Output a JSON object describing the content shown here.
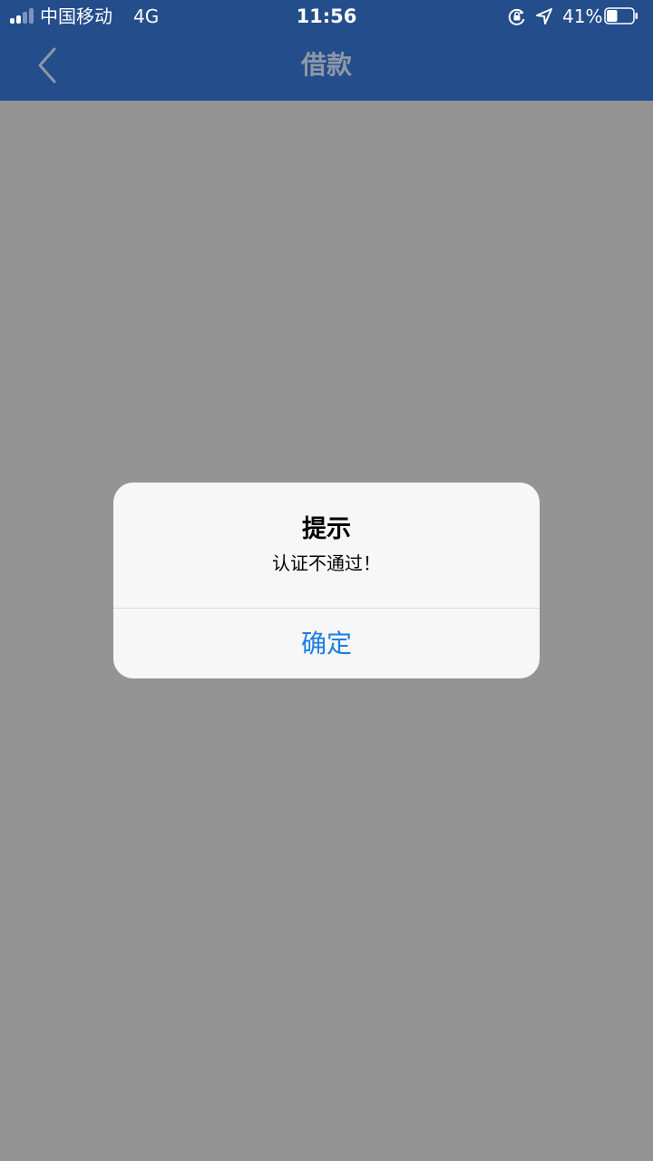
{
  "status_bar": {
    "carrier": "中国移动",
    "network": "4G",
    "time": "11:56",
    "battery_percent": "41%",
    "battery_level": 0.41,
    "icons": [
      "signal-icon",
      "rotation-lock-icon",
      "location-arrow-icon",
      "battery-icon"
    ]
  },
  "nav": {
    "title": "借款",
    "back_icon": "chevron-left-icon"
  },
  "alert": {
    "title": "提示",
    "message": "认证不通过！",
    "confirm_label": "确定"
  },
  "colors": {
    "header": "#234d8b",
    "overlay": "#949494",
    "alert_background": "#f7f7f8",
    "action": "#1b7ee3"
  }
}
